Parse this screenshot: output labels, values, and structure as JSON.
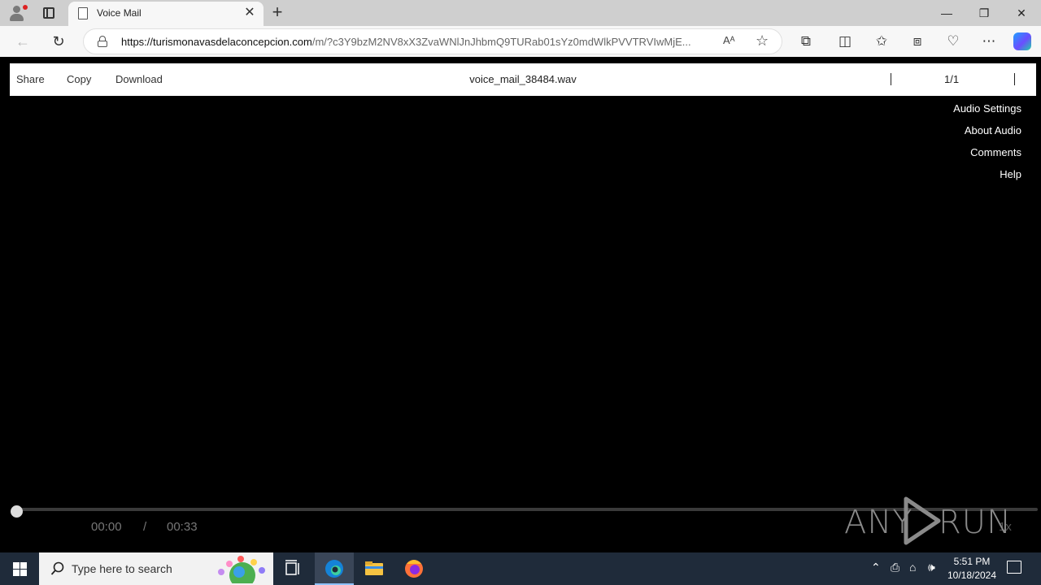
{
  "browser": {
    "tab_title": "Voice Mail",
    "tab_close": "✕",
    "new_tab": "+",
    "url_domain": "https://turismonavasdelaconcepcion.com",
    "url_path": "/m/?c3Y9bzM2NV8xX3ZvaWNlJnJhbmQ9TURab01sYz0mdWlkPVVTRVIwMjE...",
    "read_aloud": "Aᴬ",
    "favorite_star": "☆",
    "window_controls": {
      "minimize": "—",
      "restore": "❐",
      "close": "✕"
    }
  },
  "viewer": {
    "toolbar": {
      "share": "Share",
      "copy": "Copy",
      "download": "Download"
    },
    "file_name": "voice_mail_38484.wav",
    "page_indicator": "1/1",
    "side_menu": [
      "Audio Settings",
      "About Audio",
      "Comments",
      "Help"
    ],
    "player": {
      "current_time": "00:00",
      "separator": "/",
      "duration": "00:33",
      "progress_fraction": 0.0,
      "speed": "1x"
    }
  },
  "watermark": {
    "left": "ANY",
    "right": "RUN"
  },
  "taskbar": {
    "search_placeholder": "Type here to search",
    "clock_time": "5:51 PM",
    "clock_date": "10/18/2024"
  }
}
